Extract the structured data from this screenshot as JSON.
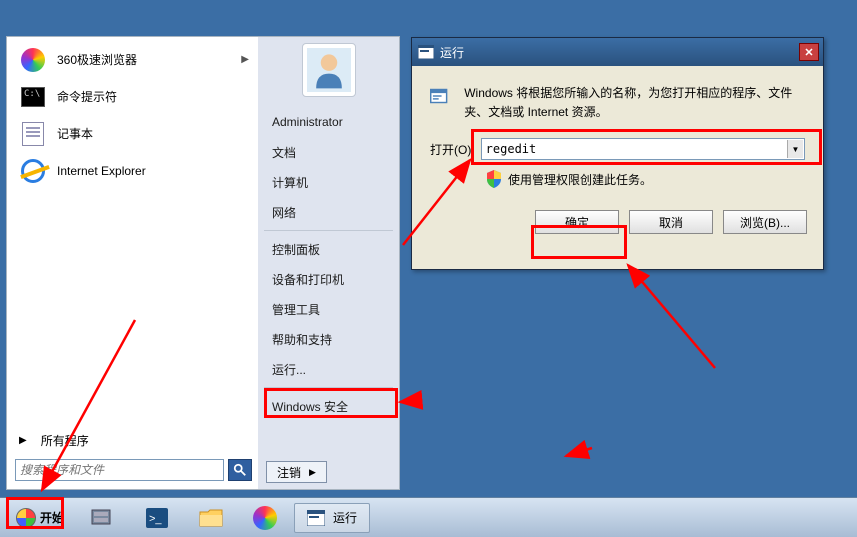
{
  "start_menu": {
    "left_items": [
      {
        "label": "360极速浏览器",
        "icon": "orb360",
        "has_sub": true
      },
      {
        "label": "命令提示符",
        "icon": "cmd"
      },
      {
        "label": "记事本",
        "icon": "notepad"
      },
      {
        "label": "Internet Explorer",
        "icon": "ie"
      }
    ],
    "all_programs": "所有程序",
    "search_placeholder": "搜索程序和文件",
    "right": {
      "username": "Administrator",
      "items1": [
        "文档",
        "计算机",
        "网络"
      ],
      "items2": [
        "控制面板",
        "设备和打印机",
        "管理工具",
        "帮助和支持",
        "运行..."
      ],
      "items3": [
        "Windows 安全"
      ],
      "logout": "注销"
    }
  },
  "run_dialog": {
    "title": "运行",
    "desc": "Windows 将根据您所输入的名称，为您打开相应的程序、文件夹、文档或 Internet 资源。",
    "open_label": "打开(O):",
    "input_value": "regedit",
    "shield_text": "使用管理权限创建此任务。",
    "btn_ok": "确定",
    "btn_cancel": "取消",
    "btn_browse": "浏览(B)..."
  },
  "taskbar": {
    "start": "开始",
    "run_task": "运行"
  }
}
